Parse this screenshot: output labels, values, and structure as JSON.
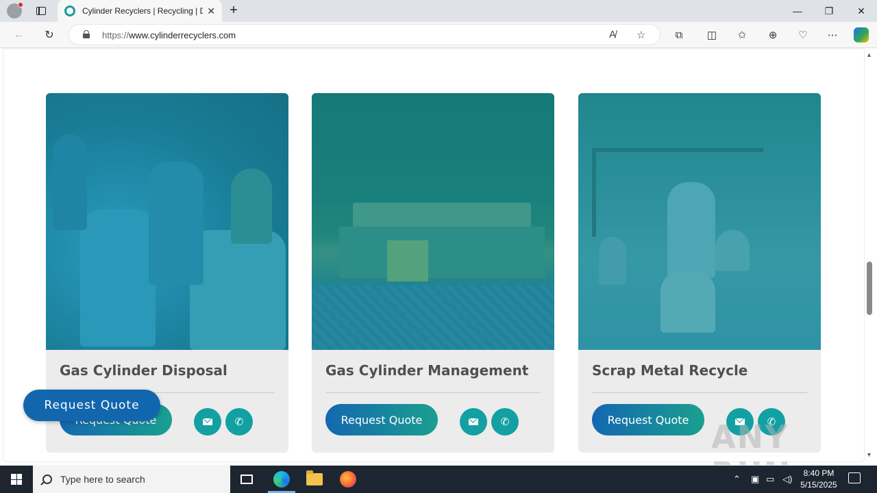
{
  "browser": {
    "tab_title": "Cylinder Recyclers | Recycling | D",
    "tab_close": "✕",
    "new_tab": "+",
    "url_protocol": "https://",
    "url_host": "www.cylinderrecyclers.com",
    "window_controls": {
      "minimize": "—",
      "restore": "❐",
      "close": "✕"
    },
    "nav": {
      "back": "←",
      "refresh": "↻"
    }
  },
  "page": {
    "cards": [
      {
        "title": "Gas Cylinder Disposal",
        "quote_label": "Request Quote"
      },
      {
        "title": "Gas Cylinder Management",
        "quote_label": "Request Quote"
      },
      {
        "title": "Scrap Metal Recycle",
        "quote_label": "Request Quote"
      }
    ],
    "floating_quote_label": "Request Quote",
    "phone_icon": "✆",
    "accent_color": "#13a0a3",
    "button_gradient": [
      "#1467b0",
      "#1aa08f"
    ]
  },
  "watermark": "ANY RUN",
  "taskbar": {
    "search_placeholder": "Type here to search",
    "time": "8:40 PM",
    "date": "5/15/2025"
  }
}
